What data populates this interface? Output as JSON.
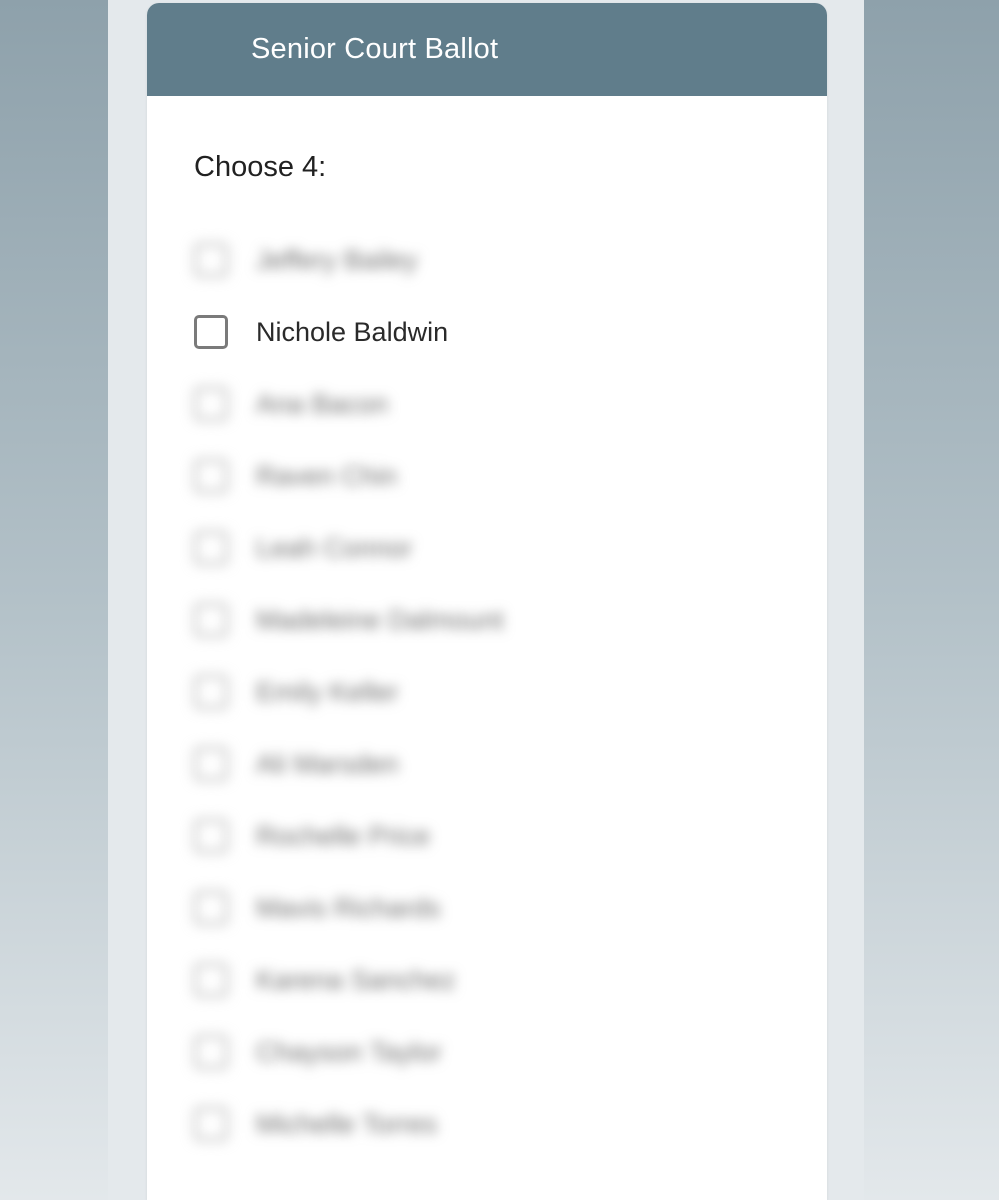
{
  "ballot": {
    "title": "Senior Court Ballot",
    "instruction": "Choose 4:",
    "options": [
      {
        "label": "Jeffery Bailey",
        "blurred": true
      },
      {
        "label": "Nichole Baldwin",
        "blurred": false
      },
      {
        "label": "Ana Bacon",
        "blurred": true
      },
      {
        "label": "Raven Chin",
        "blurred": true
      },
      {
        "label": "Leah Connor",
        "blurred": true
      },
      {
        "label": "Madeleine Dalmount",
        "blurred": true
      },
      {
        "label": "Emily Keller",
        "blurred": true
      },
      {
        "label": "Ali Marsden",
        "blurred": true
      },
      {
        "label": "Rochelle Price",
        "blurred": true
      },
      {
        "label": "Mavis Richards",
        "blurred": true
      },
      {
        "label": "Karena Sanchez",
        "blurred": true
      },
      {
        "label": "Chayson Taylor",
        "blurred": true
      },
      {
        "label": "Michelle Torres",
        "blurred": true
      }
    ]
  },
  "colors": {
    "header": "#607d8b",
    "checkbox_border": "#7a7a7a"
  }
}
